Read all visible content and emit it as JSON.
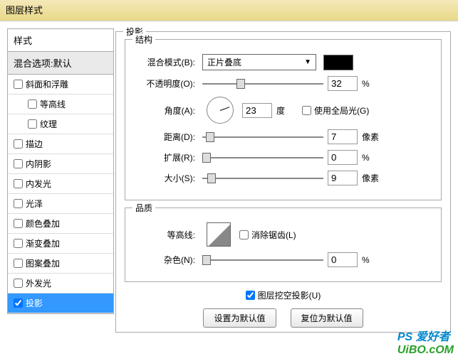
{
  "window": {
    "title": "图层样式"
  },
  "left": {
    "styles_header": "样式",
    "blend_default": "混合选项:默认",
    "items": [
      {
        "label": "斜面和浮雕",
        "checked": false,
        "indent": false
      },
      {
        "label": "等高线",
        "checked": false,
        "indent": true
      },
      {
        "label": "纹理",
        "checked": false,
        "indent": true
      },
      {
        "label": "描边",
        "checked": false,
        "indent": false
      },
      {
        "label": "内阴影",
        "checked": false,
        "indent": false
      },
      {
        "label": "内发光",
        "checked": false,
        "indent": false
      },
      {
        "label": "光泽",
        "checked": false,
        "indent": false
      },
      {
        "label": "颜色叠加",
        "checked": false,
        "indent": false
      },
      {
        "label": "渐变叠加",
        "checked": false,
        "indent": false
      },
      {
        "label": "图案叠加",
        "checked": false,
        "indent": false
      },
      {
        "label": "外发光",
        "checked": false,
        "indent": false
      },
      {
        "label": "投影",
        "checked": true,
        "indent": false,
        "selected": true
      }
    ]
  },
  "right": {
    "section_title": "投影",
    "structure": {
      "legend": "结构",
      "blend_mode": {
        "label": "混合模式(B):",
        "value": "正片叠底",
        "color": "#000000"
      },
      "opacity": {
        "label": "不透明度(O):",
        "value": "32",
        "unit": "%",
        "thumb_pct": 28
      },
      "angle": {
        "label": "角度(A):",
        "value": "23",
        "unit": "度",
        "global_label": "使用全局光(G)",
        "global_checked": false
      },
      "distance": {
        "label": "距离(D):",
        "value": "7",
        "unit": "像素",
        "thumb_pct": 3
      },
      "spread": {
        "label": "扩展(R):",
        "value": "0",
        "unit": "%",
        "thumb_pct": 0
      },
      "size": {
        "label": "大小(S):",
        "value": "9",
        "unit": "像素",
        "thumb_pct": 4
      }
    },
    "quality": {
      "legend": "品质",
      "contour": {
        "label": "等高线:",
        "antialias_label": "消除锯齿(L)",
        "antialias_checked": false
      },
      "noise": {
        "label": "杂色(N):",
        "value": "0",
        "unit": "%",
        "thumb_pct": 0
      }
    },
    "knockout": {
      "label": "图层挖空投影(U)",
      "checked": true
    },
    "buttons": {
      "default": "设置为默认值",
      "reset": "复位为默认值"
    }
  },
  "watermark": {
    "text1": "PS 爱好者",
    "text2": "UiBO.cOM"
  }
}
